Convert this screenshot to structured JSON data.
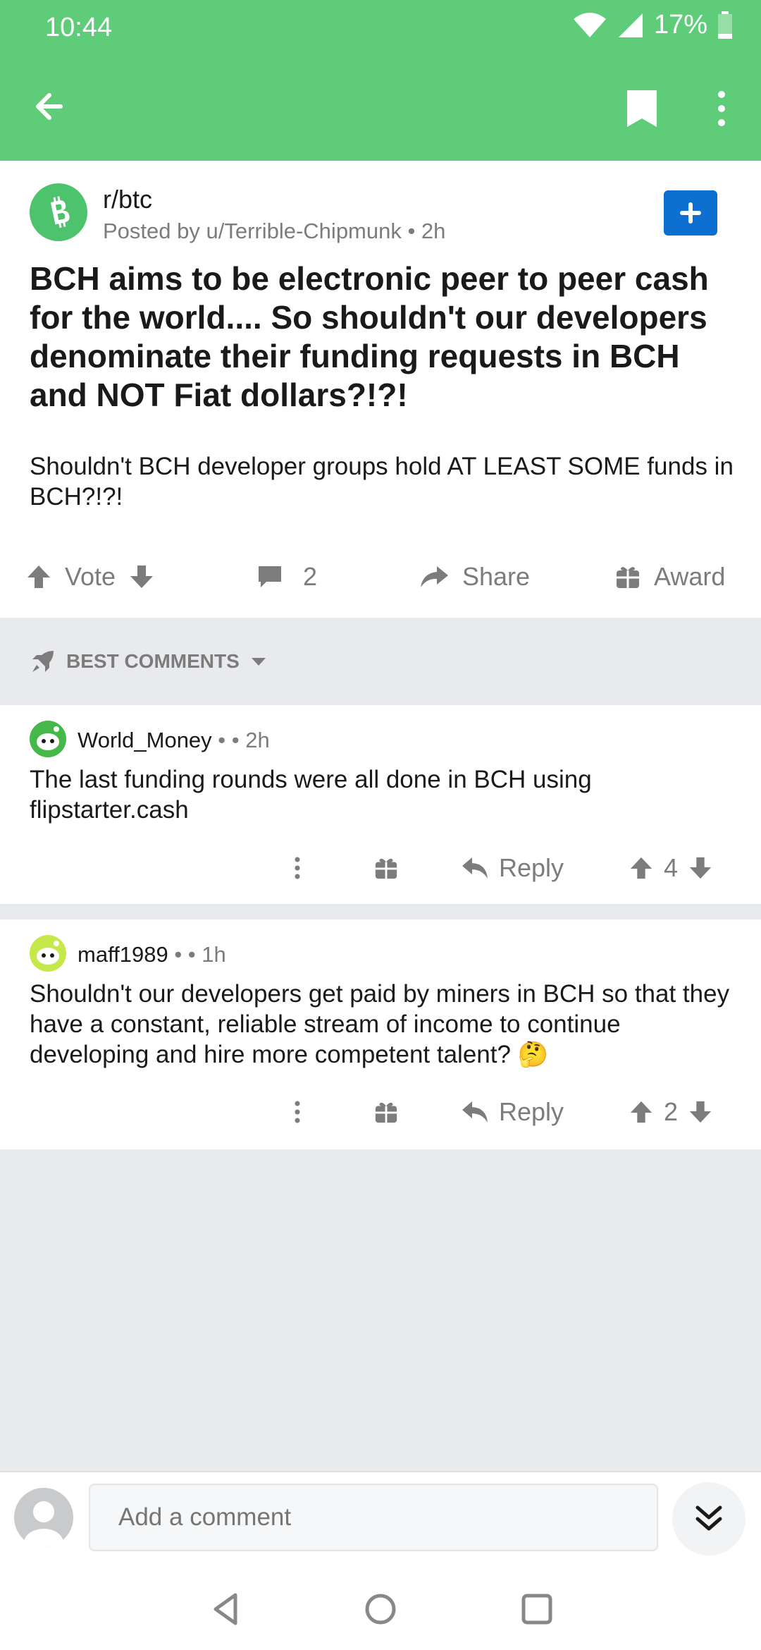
{
  "status": {
    "time": "10:44",
    "battery": "17%"
  },
  "post": {
    "subreddit": "r/btc",
    "posted_by": "Posted by u/Terrible-Chipmunk • 2h",
    "title": "BCH aims to be electronic peer to peer cash for the world.... So shouldn't our developers denominate their funding requests in BCH and NOT Fiat dollars?!?!",
    "body": "Shouldn't BCH developer groups hold AT LEAST SOME funds in BCH?!?!",
    "vote_label": "Vote",
    "comment_count": "2",
    "share_label": "Share",
    "award_label": "Award"
  },
  "sort": {
    "label": "BEST COMMENTS"
  },
  "comments": [
    {
      "author": "World_Money",
      "sep": " •  • ",
      "age": "2h",
      "body": "The last funding rounds were all done in BCH using flipstarter.cash",
      "reply_label": "Reply",
      "score": "4"
    },
    {
      "author": "maff1989",
      "sep": " •  • ",
      "age": "1h",
      "body": "Shouldn't our developers get paid by miners in BCH so that they have a constant, reliable stream of income to continue developing and hire more competent talent? 🤔",
      "reply_label": "Reply",
      "score": "2"
    }
  ],
  "composer": {
    "placeholder": "Add a comment"
  },
  "colors": {
    "header": "#5fcc79",
    "join": "#0d6fd0",
    "muted": "#7c7c7c"
  }
}
